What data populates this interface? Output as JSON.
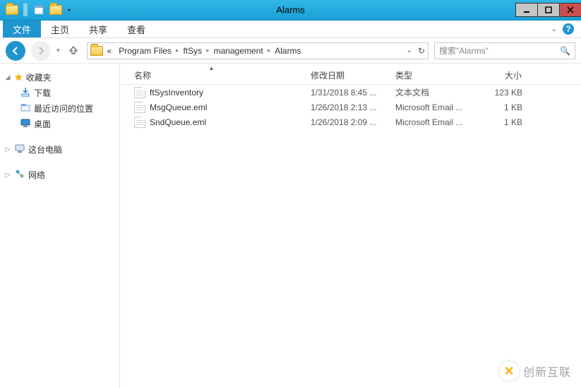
{
  "window": {
    "title": "Alarms"
  },
  "menubar": {
    "file": "文件",
    "tabs": [
      "主页",
      "共享",
      "查看"
    ]
  },
  "nav": {
    "crumbs_prefix": "«",
    "crumbs": [
      "Program Files",
      "ftSys",
      "management",
      "Alarms"
    ],
    "search_placeholder": "搜索\"Alarms\""
  },
  "sidebar": {
    "favorites": {
      "label": "收藏夹",
      "items": [
        {
          "label": "下载",
          "icon": "download"
        },
        {
          "label": "最近访问的位置",
          "icon": "recent"
        },
        {
          "label": "桌面",
          "icon": "desktop"
        }
      ]
    },
    "this_pc": {
      "label": "这台电脑"
    },
    "network": {
      "label": "网络"
    }
  },
  "columns": {
    "name": "名称",
    "date": "修改日期",
    "type": "类型",
    "size": "大小"
  },
  "files": [
    {
      "name": "ftSysInventory",
      "date": "1/31/2018 8:45 ...",
      "type": "文本文档",
      "size": "123 KB"
    },
    {
      "name": "MsgQueue.eml",
      "date": "1/26/2018 2:13 ...",
      "type": "Microsoft Email ...",
      "size": "1 KB"
    },
    {
      "name": "SndQueue.eml",
      "date": "1/26/2018 2:09 ...",
      "type": "Microsoft Email ...",
      "size": "1 KB"
    }
  ],
  "watermark": "创新互联"
}
